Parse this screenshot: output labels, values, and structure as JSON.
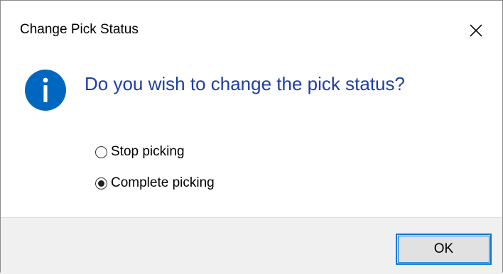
{
  "window": {
    "title": "Change Pick Status",
    "close_icon": "close-icon"
  },
  "message": {
    "icon": "info-icon",
    "text": "Do you wish to change the pick status?"
  },
  "options": [
    {
      "label": "Stop picking",
      "selected": false
    },
    {
      "label": "Complete picking",
      "selected": true
    }
  ],
  "footer": {
    "ok_label": "OK"
  },
  "colors": {
    "instruction_text": "#1e3ea6",
    "info_icon": "#0067c0",
    "focus_border": "#0078d7",
    "footer_bg": "#f0f0f0"
  }
}
